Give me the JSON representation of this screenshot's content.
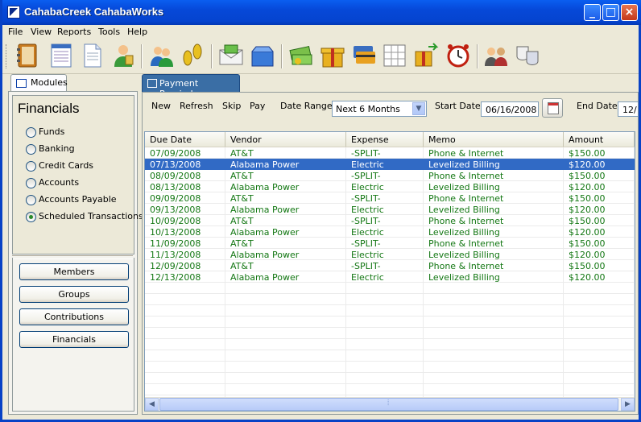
{
  "window": {
    "title": "CahabaCreek CahabaWorks"
  },
  "menu": [
    "File",
    "View",
    "Reports",
    "Tools",
    "Help"
  ],
  "toolbar_icons": [
    "address-book-icon",
    "spreadsheet-icon",
    "document-icon",
    "member-icon",
    "group-icon",
    "footprints-icon",
    "envelope-money-icon",
    "box-icon",
    "cash-icon",
    "gift-icon",
    "credit-cards-icon",
    "grid-icon",
    "gift-transfer-icon",
    "alarm-clock-icon",
    "people-icon",
    "drama-masks-icon"
  ],
  "left": {
    "tab_label": "Modules",
    "title": "Financials",
    "radios": [
      {
        "label": "Funds",
        "checked": false
      },
      {
        "label": "Banking",
        "checked": false
      },
      {
        "label": "Credit Cards",
        "checked": false
      },
      {
        "label": "Accounts",
        "checked": false
      },
      {
        "label": "Accounts Payable",
        "checked": false
      },
      {
        "label": "Scheduled Transactions",
        "checked": true
      }
    ],
    "buttons": [
      "Members",
      "Groups",
      "Contributions",
      "Financials"
    ]
  },
  "right": {
    "tab_label": "Payment Reminders",
    "actions": [
      "New",
      "Refresh",
      "Skip",
      "Pay"
    ],
    "date_range_label": "Date Range:",
    "date_range_value": "Next 6 Months",
    "start_date_label": "Start Date:",
    "start_date_value": "06/16/2008",
    "end_date_label": "End Date:",
    "end_date_value": "12/"
  },
  "table": {
    "columns": [
      "Due Date",
      "Vendor",
      "Expense",
      "Memo",
      "Amount"
    ],
    "rows": [
      [
        "07/09/2008",
        "AT&T",
        "-SPLIT-",
        "Phone & Internet",
        "$150.00"
      ],
      [
        "07/13/2008",
        "Alabama Power",
        "Electric",
        "Levelized Billing",
        "$120.00"
      ],
      [
        "08/09/2008",
        "AT&T",
        "-SPLIT-",
        "Phone & Internet",
        "$150.00"
      ],
      [
        "08/13/2008",
        "Alabama Power",
        "Electric",
        "Levelized Billing",
        "$120.00"
      ],
      [
        "09/09/2008",
        "AT&T",
        "-SPLIT-",
        "Phone & Internet",
        "$150.00"
      ],
      [
        "09/13/2008",
        "Alabama Power",
        "Electric",
        "Levelized Billing",
        "$120.00"
      ],
      [
        "10/09/2008",
        "AT&T",
        "-SPLIT-",
        "Phone & Internet",
        "$150.00"
      ],
      [
        "10/13/2008",
        "Alabama Power",
        "Electric",
        "Levelized Billing",
        "$120.00"
      ],
      [
        "11/09/2008",
        "AT&T",
        "-SPLIT-",
        "Phone & Internet",
        "$150.00"
      ],
      [
        "11/13/2008",
        "Alabama Power",
        "Electric",
        "Levelized Billing",
        "$120.00"
      ],
      [
        "12/09/2008",
        "AT&T",
        "-SPLIT-",
        "Phone & Internet",
        "$150.00"
      ],
      [
        "12/13/2008",
        "Alabama Power",
        "Electric",
        "Levelized Billing",
        "$120.00"
      ]
    ],
    "selected_row": 1,
    "row_text_color": "#137713",
    "selection_color": "#316ac5"
  }
}
